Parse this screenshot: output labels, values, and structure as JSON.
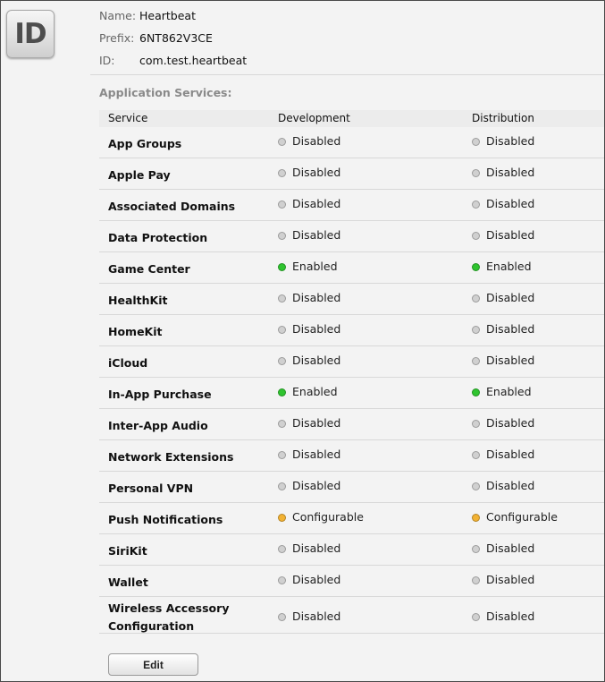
{
  "icon": {
    "label": "ID",
    "name": "app-id-icon"
  },
  "meta": [
    {
      "key": "Name:",
      "value": "Heartbeat"
    },
    {
      "key": "Prefix:",
      "value": "6NT862V3CE"
    },
    {
      "key": "ID:",
      "value": "com.test.heartbeat"
    }
  ],
  "services_title": "Application Services:",
  "table": {
    "headers": {
      "service": "Service",
      "development": "Development",
      "distribution": "Distribution"
    },
    "rows": [
      {
        "service": "App Groups",
        "development": "Disabled",
        "distribution": "Disabled"
      },
      {
        "service": "Apple Pay",
        "development": "Disabled",
        "distribution": "Disabled"
      },
      {
        "service": "Associated Domains",
        "development": "Disabled",
        "distribution": "Disabled"
      },
      {
        "service": "Data Protection",
        "development": "Disabled",
        "distribution": "Disabled"
      },
      {
        "service": "Game Center",
        "development": "Enabled",
        "distribution": "Enabled"
      },
      {
        "service": "HealthKit",
        "development": "Disabled",
        "distribution": "Disabled"
      },
      {
        "service": "HomeKit",
        "development": "Disabled",
        "distribution": "Disabled"
      },
      {
        "service": "iCloud",
        "development": "Disabled",
        "distribution": "Disabled"
      },
      {
        "service": "In-App Purchase",
        "development": "Enabled",
        "distribution": "Enabled"
      },
      {
        "service": "Inter-App Audio",
        "development": "Disabled",
        "distribution": "Disabled"
      },
      {
        "service": "Network Extensions",
        "development": "Disabled",
        "distribution": "Disabled"
      },
      {
        "service": "Personal VPN",
        "development": "Disabled",
        "distribution": "Disabled"
      },
      {
        "service": "Push Notifications",
        "development": "Configurable",
        "distribution": "Configurable"
      },
      {
        "service": "SiriKit",
        "development": "Disabled",
        "distribution": "Disabled"
      },
      {
        "service": "Wallet",
        "development": "Disabled",
        "distribution": "Disabled"
      },
      {
        "service": "Wireless Accessory Configuration",
        "development": "Disabled",
        "distribution": "Disabled"
      }
    ]
  },
  "status_colors": {
    "Disabled": "#d0d0d0",
    "Enabled": "#2fc42f",
    "Configurable": "#f2b233"
  },
  "edit_button": {
    "label": "Edit"
  }
}
